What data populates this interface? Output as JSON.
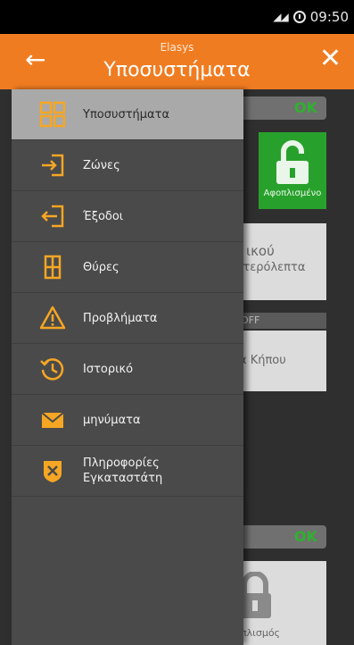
{
  "status_bar": {
    "time": "09:50"
  },
  "app_bar": {
    "subtitle": "Elasys",
    "title": "Υποσυστήματα"
  },
  "drawer": {
    "items": [
      {
        "label": "Υποσυστήματα",
        "icon": "grid-icon",
        "active": true
      },
      {
        "label": "Ζώνες",
        "icon": "enter-icon"
      },
      {
        "label": "Έξοδοι",
        "icon": "exit-icon"
      },
      {
        "label": "Θύρες",
        "icon": "door-icon"
      },
      {
        "label": "Προβλήματα",
        "icon": "warning-icon"
      },
      {
        "label": "Ιστορικό",
        "icon": "history-icon"
      },
      {
        "label": "μηνύματα",
        "icon": "envelope-icon"
      },
      {
        "label": "Πληροφορίες Εγκαταστάτη",
        "icon": "installer-badge-icon"
      }
    ]
  },
  "background": {
    "ok_top": "OK",
    "ok_bottom": "OK",
    "tile_green_label": "Αφοπλισμένο",
    "tile1_line1": "ικού",
    "tile1_line2": "ιτερόλεπτα",
    "off_label": "OFF",
    "tile2_label": "α Κήπου",
    "tile3_label": "πλισμός"
  },
  "colors": {
    "accent": "#f07c21",
    "icon": "#f6a623",
    "ok_green": "#2fb12f"
  }
}
